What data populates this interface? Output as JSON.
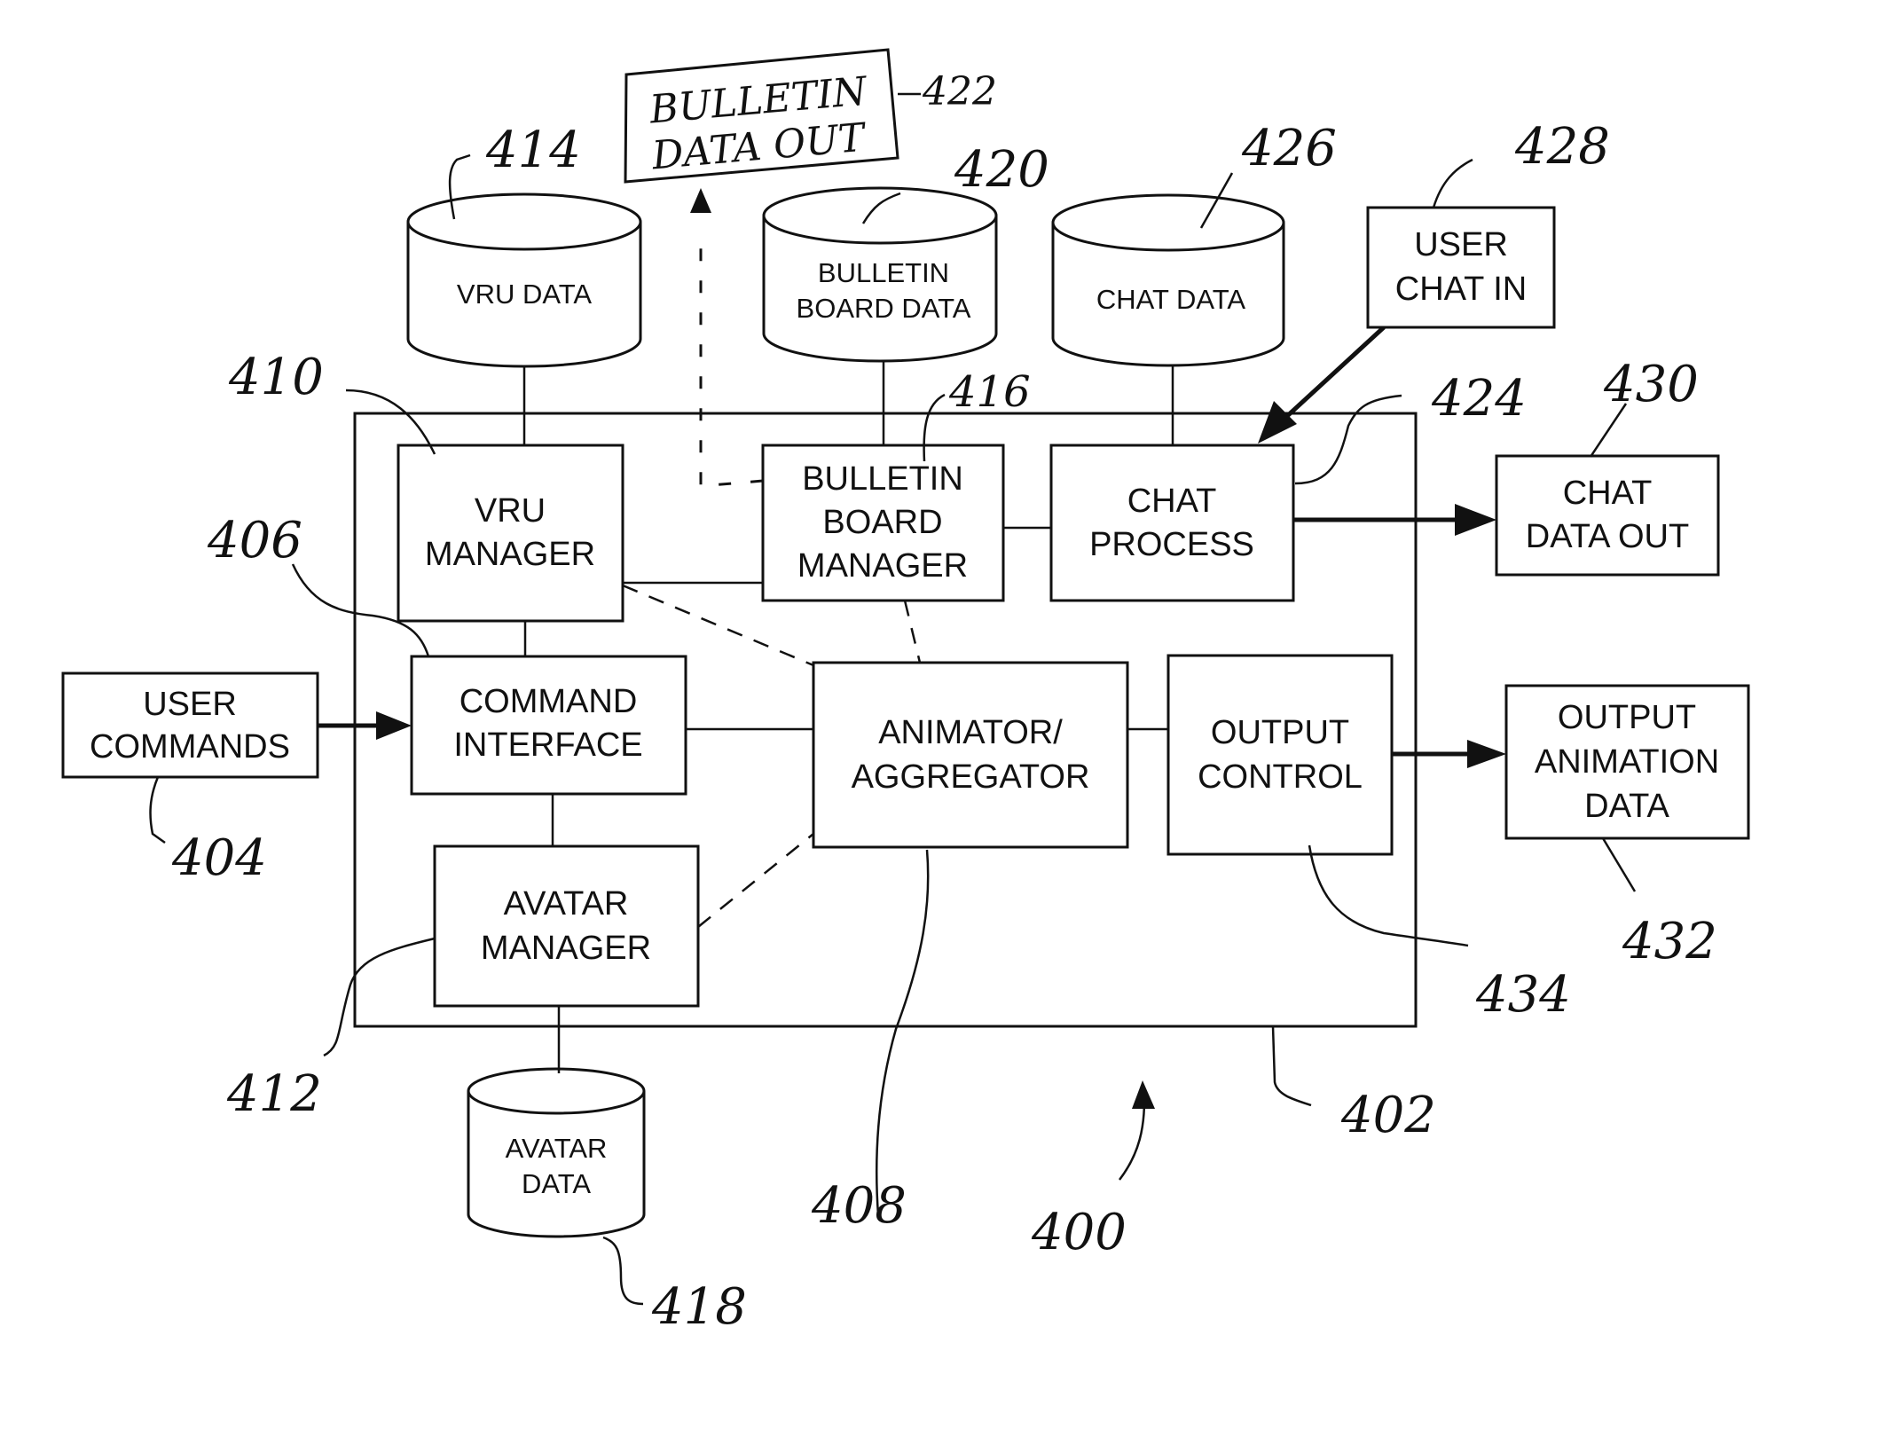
{
  "figure": {
    "ref_main": "400",
    "ref_container": "402"
  },
  "blocks": {
    "user_commands": {
      "lines": [
        "USER",
        "COMMANDS"
      ],
      "ref": "404"
    },
    "command_interface": {
      "lines": [
        "COMMAND",
        "INTERFACE"
      ],
      "ref": "406"
    },
    "animator_aggregator": {
      "lines": [
        "ANIMATOR/",
        "AGGREGATOR"
      ],
      "ref": "408"
    },
    "vru_manager": {
      "lines": [
        "VRU",
        "MANAGER"
      ],
      "ref": "410"
    },
    "avatar_manager": {
      "lines": [
        "AVATAR",
        "MANAGER"
      ],
      "ref": "412"
    },
    "bulletin_board_manager": {
      "lines": [
        "BULLETIN",
        "BOARD",
        "MANAGER"
      ],
      "ref": "416"
    },
    "chat_process": {
      "lines": [
        "CHAT",
        "PROCESS"
      ],
      "ref": "424"
    },
    "user_chat_in": {
      "lines": [
        "USER",
        "CHAT IN"
      ],
      "ref": "428"
    },
    "chat_data_out": {
      "lines": [
        "CHAT",
        "DATA OUT"
      ],
      "ref": "430"
    },
    "output_animation_data": {
      "lines": [
        "OUTPUT",
        "ANIMATION",
        "DATA"
      ],
      "ref": "432"
    },
    "output_control": {
      "lines": [
        "OUTPUT",
        "CONTROL"
      ],
      "ref": "434"
    },
    "bulletin_data_out": {
      "lines": [
        "BULLETIN",
        "DATA OUT"
      ],
      "ref": "422"
    }
  },
  "stores": {
    "vru_data": {
      "lines": [
        "VRU DATA"
      ],
      "ref": "414"
    },
    "avatar_data": {
      "lines": [
        "AVATAR",
        "DATA"
      ],
      "ref": "418"
    },
    "bulletin_board_data": {
      "lines": [
        "BULLETIN",
        "BOARD DATA"
      ],
      "ref": "420"
    },
    "chat_data": {
      "lines": [
        "CHAT DATA"
      ],
      "ref": "426"
    }
  }
}
